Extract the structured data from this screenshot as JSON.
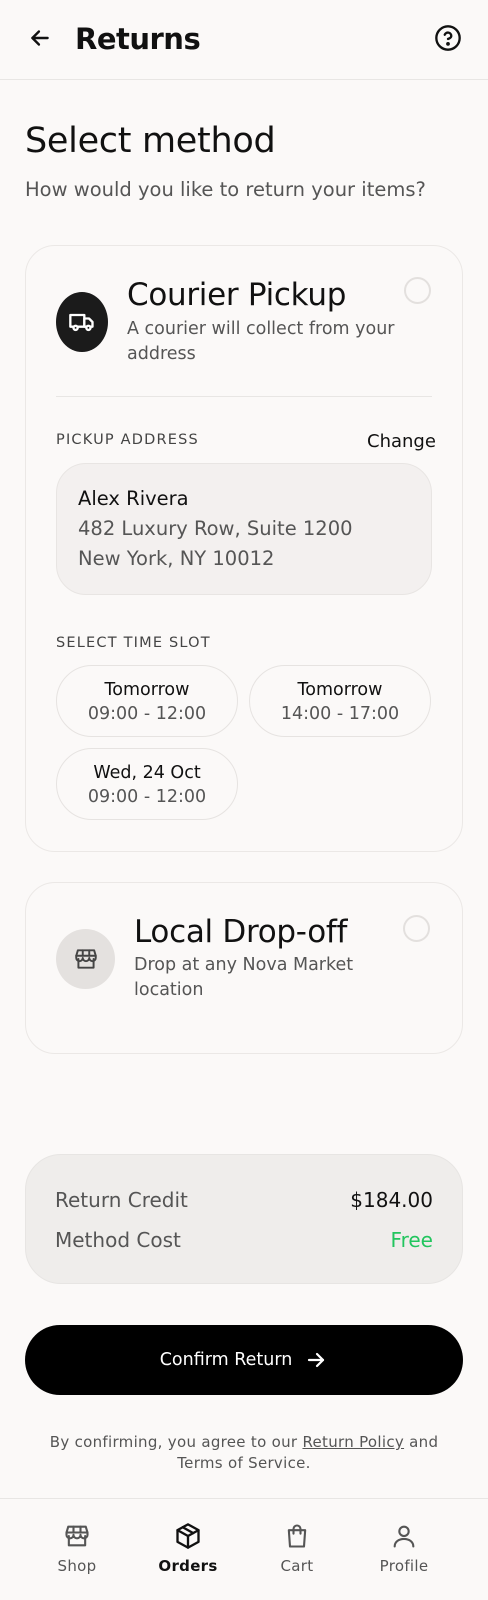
{
  "header": {
    "title": "Returns"
  },
  "page": {
    "title": "Select method",
    "subtitle": "How would you like to return your items?"
  },
  "courier": {
    "title": "Courier Pickup",
    "description": "A courier will collect from your address",
    "icon": "truck-icon",
    "selected": false,
    "pickup_label": "PICKUP ADDRESS",
    "change_label": "Change",
    "address": {
      "name": "Alex Rivera",
      "line1": "482 Luxury Row, Suite 1200",
      "line2": "New York, NY 10012"
    },
    "slot_label": "SELECT TIME SLOT",
    "slots": [
      {
        "day": "Tomorrow",
        "time": "09:00 - 12:00"
      },
      {
        "day": "Tomorrow",
        "time": "14:00 - 17:00"
      },
      {
        "day": "Wed, 24 Oct",
        "time": "09:00 - 12:00"
      }
    ]
  },
  "dropoff": {
    "title": "Local Drop-off",
    "description": "Drop at any Nova Market location",
    "icon": "store-icon",
    "selected": false
  },
  "summary": {
    "credit_label": "Return Credit",
    "credit_value": "$184.00",
    "cost_label": "Method Cost",
    "cost_value": "Free",
    "free_color": "#22c55e"
  },
  "confirm": {
    "label": "Confirm Return"
  },
  "terms": {
    "prefix": "By confirming, you agree to our",
    "link": "Return Policy",
    "suffix": "and Terms of Service."
  },
  "nav": {
    "items": [
      {
        "label": "Shop",
        "icon": "store-icon",
        "active": false
      },
      {
        "label": "Orders",
        "icon": "box-icon",
        "active": true
      },
      {
        "label": "Cart",
        "icon": "bag-icon",
        "active": false
      },
      {
        "label": "Profile",
        "icon": "user-icon",
        "active": false
      }
    ]
  }
}
